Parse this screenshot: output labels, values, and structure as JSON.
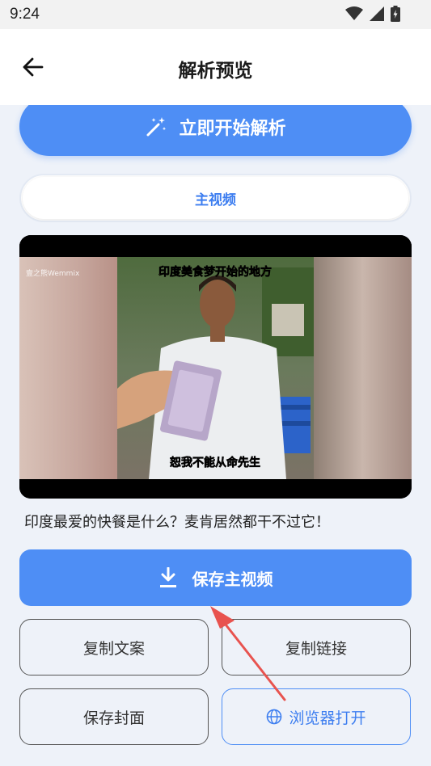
{
  "status_bar": {
    "time": "9:24"
  },
  "header": {
    "title": "解析预览"
  },
  "parse_button": {
    "label": "立即开始解析"
  },
  "tab": {
    "label": "主视频"
  },
  "video": {
    "top_caption": "印度美食梦开始的地方",
    "bottom_caption": "恕我不能从命先生",
    "watermark": "壹之熊Wemmix"
  },
  "video_title": "印度最爱的快餐是什么？麦肯居然都干不过它！",
  "save_video_button": {
    "label": "保存主视频"
  },
  "actions": {
    "copy_text": "复制文案",
    "copy_link": "复制链接",
    "save_cover": "保存封面",
    "open_browser": "浏览器打开"
  },
  "colors": {
    "accent": "#4e8ef5",
    "annotation_arrow": "#e8534f"
  }
}
